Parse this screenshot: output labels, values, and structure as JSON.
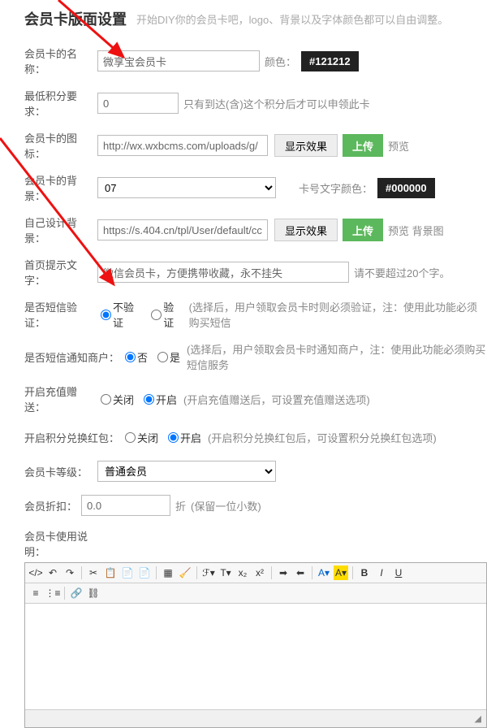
{
  "header": {
    "title": "会员卡版面设置",
    "subtitle": "开始DIY你的会员卡吧，logo、背景以及字体颜色都可以自由调整。"
  },
  "fields": {
    "name": {
      "label": "会员卡的名称：",
      "value": "微享宝会员卡",
      "color_label": "颜色：",
      "color_value": "#121212"
    },
    "minpoints": {
      "label": "最低积分要求：",
      "value": "0",
      "hint": "只有到达(含)这个积分后才可以申领此卡"
    },
    "icon": {
      "label": "会员卡的图标：",
      "value": "http://wx.wxbcms.com/uploads/g/",
      "btn_show": "显示效果",
      "btn_upload": "上传",
      "preview": "预览"
    },
    "bg": {
      "label": "会员卡的背景：",
      "value": "07",
      "cardnum_label": "卡号文字颜色：",
      "cardnum_value": "#000000"
    },
    "custom_bg": {
      "label": "自己设计背景：",
      "value": "https://s.404.cn/tpl/User/default/cc",
      "btn_show": "显示效果",
      "btn_upload": "上传",
      "preview": "预览 背景图"
    },
    "home_text": {
      "label": "首页提示文字：",
      "value": "微信会员卡，方便携带收藏，永不挂失",
      "hint": "请不要超过20个字。"
    },
    "sms_verify": {
      "label": "是否短信验证：",
      "opt1": "不验证",
      "opt2": "验证",
      "note": "(选择后，用户领取会员卡时则必须验证，注：使用此功能必须购买短信"
    },
    "sms_notify": {
      "label": "是否短信通知商户：",
      "opt1": "否",
      "opt2": "是",
      "note": "(选择后，用户领取会员卡时通知商户，注：使用此功能必须购买短信服务"
    },
    "recharge": {
      "label": "开启充值赠送：",
      "opt1": "关闭",
      "opt2": "开启",
      "note": "(开启充值赠送后，可设置充值赠送选项)"
    },
    "redpack": {
      "label": "开启积分兑换红包：",
      "opt1": "关闭",
      "opt2": "开启",
      "note": "(开启积分兑换红包后，可设置积分兑换红包选项)"
    },
    "level": {
      "label": "会员卡等级：",
      "value": "普通会员"
    },
    "discount": {
      "label": "会员折扣：",
      "value": "0.0",
      "unit": "折",
      "hint": "(保留一位小数)"
    },
    "desc": {
      "label": "会员卡使用说明："
    }
  },
  "toolbar": {
    "bold": "B",
    "italic": "I",
    "underline": "U"
  }
}
